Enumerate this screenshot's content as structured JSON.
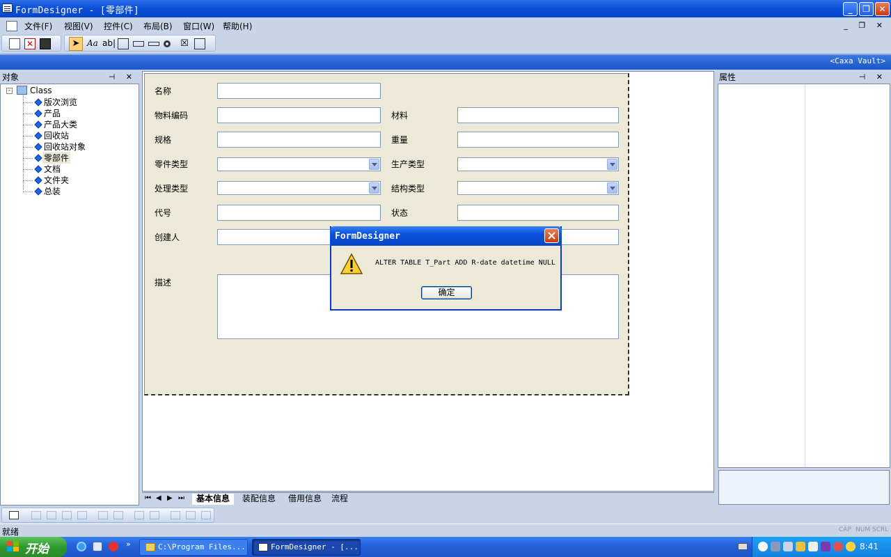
{
  "window": {
    "title": "FormDesigner - [零部件]"
  },
  "menu": [
    "文件(F)",
    "视图(V)",
    "控件(C)",
    "布局(B)",
    "窗口(W)",
    "帮助(H)"
  ],
  "header": {
    "vault": "<Caxa Vault>"
  },
  "object_panel": {
    "title": "对象",
    "root": "Class",
    "items": [
      "版次浏览",
      "产品",
      "产品大类",
      "回收站",
      "回收站对象",
      "零部件",
      "文档",
      "文件夹",
      "总装"
    ],
    "selected": "零部件"
  },
  "property_panel": {
    "title": "属性"
  },
  "form": {
    "fields": {
      "name": "名称",
      "material_code": "物料编码",
      "material": "材料",
      "spec": "规格",
      "weight": "重量",
      "part_type": "零件类型",
      "production_type": "生产类型",
      "process_type": "处理类型",
      "structure_type": "结构类型",
      "code": "代号",
      "status": "状态",
      "creator": "创建人",
      "description": "描述"
    }
  },
  "tabs": [
    "基本信息",
    "装配信息",
    "借用信息",
    "流程"
  ],
  "active_tab": "基本信息",
  "status": {
    "text": "就绪",
    "indicators": [
      "CAP",
      "NUM",
      "SCRL"
    ]
  },
  "dialog": {
    "title": "FormDesigner",
    "message": "ALTER TABLE T_Part ADD R-date datetime NULL",
    "ok_label": "确定"
  },
  "taskbar": {
    "start_label": "开始",
    "tasks": [
      "C:\\Program Files...",
      "FormDesigner - [..."
    ],
    "clock": "8:41"
  },
  "colors": {
    "title_blue": "#0a4fd8",
    "form_bg": "#ece9d8",
    "start_green": "#2f9a2f"
  }
}
